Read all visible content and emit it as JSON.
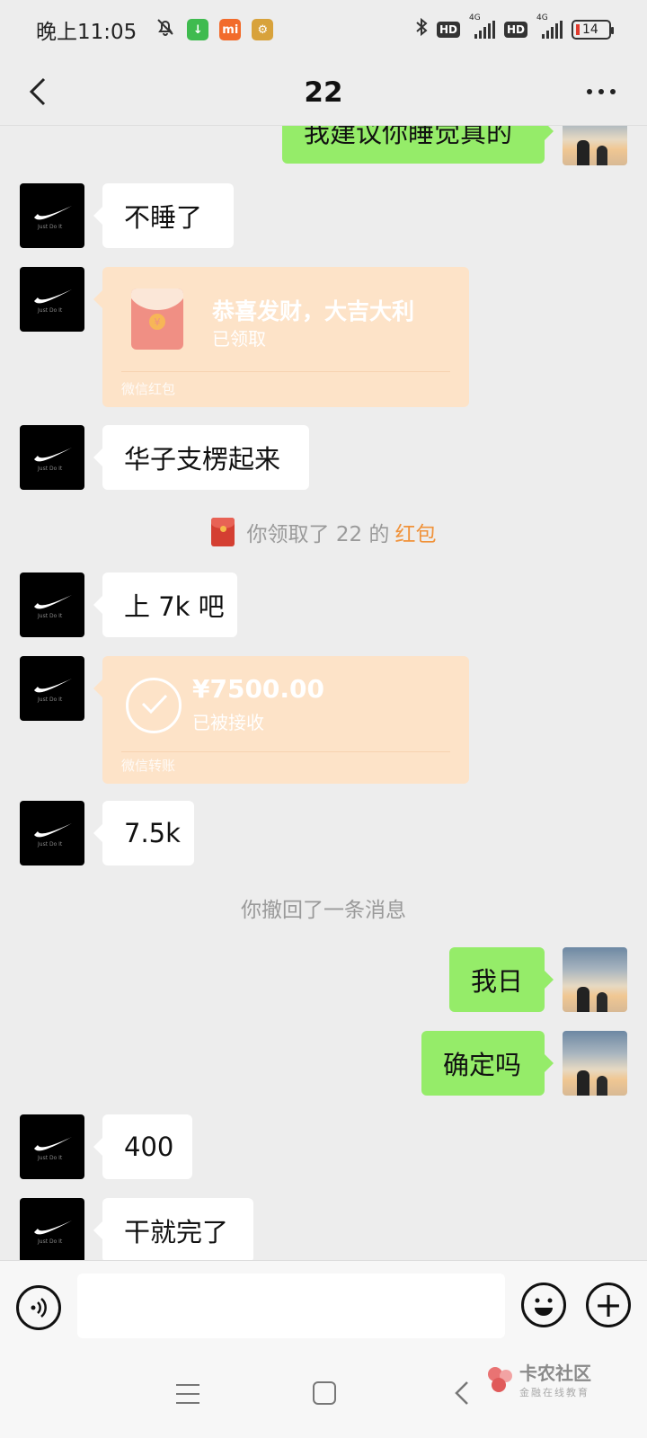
{
  "status_bar": {
    "time": "晚上11:05",
    "battery": "14",
    "hd_label": "HD",
    "network_label": "4G",
    "icons": [
      "bell-mute-icon",
      "download-app-icon",
      "mi-app-icon",
      "settings-app-icon",
      "bluetooth-icon",
      "signal-icon",
      "battery-icon"
    ]
  },
  "header": {
    "title": "22"
  },
  "messages": {
    "m0": {
      "side": "right",
      "text": "我建议你睡觉真的"
    },
    "m1": {
      "side": "left",
      "text": "不睡了"
    },
    "m2": {
      "type": "red_packet",
      "title": "恭喜发财，大吉大利",
      "status": "已领取",
      "footer": "微信红包"
    },
    "m3": {
      "side": "left",
      "text": "华子支楞起来"
    },
    "sys1": {
      "prefix": "你领取了 22 的",
      "link": "红包"
    },
    "m4": {
      "side": "left",
      "text": "上 7k 吧"
    },
    "m5": {
      "type": "transfer",
      "amount": "¥7500.00",
      "status": "已被接收",
      "footer": "微信转账"
    },
    "m6": {
      "side": "left",
      "text": "7.5k"
    },
    "sys2": {
      "text": "你撤回了一条消息"
    },
    "m7": {
      "side": "right",
      "text": "我日"
    },
    "m8": {
      "side": "right",
      "text": "确定吗"
    },
    "m9": {
      "side": "left",
      "text": "400"
    },
    "m10": {
      "side": "left",
      "text": "干就完了"
    }
  },
  "avatar_text": "Just Do It",
  "input_bar": {
    "placeholder": ""
  },
  "watermark": {
    "title": "卡农社区",
    "subtitle": "金融在线教育"
  },
  "colors": {
    "background": "#ededed",
    "bubble_self": "#95ec69",
    "bubble_other": "#ffffff",
    "card": "#fde3c8",
    "link": "#f0923a"
  }
}
